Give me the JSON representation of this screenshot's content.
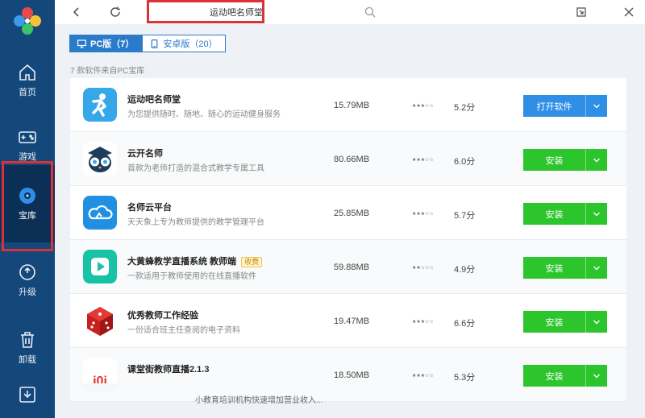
{
  "sidebar": {
    "items": [
      {
        "label": "首页",
        "icon": "home-icon"
      },
      {
        "label": "游戏",
        "icon": "gamepad-icon"
      },
      {
        "label": "宝库",
        "icon": "disc-icon",
        "active": true
      },
      {
        "label": "升级",
        "icon": "upgrade-icon"
      },
      {
        "label": "卸载",
        "icon": "trash-icon"
      },
      {
        "label": "",
        "icon": "download-icon"
      }
    ]
  },
  "search": {
    "value": "运动吧名师堂"
  },
  "tabs": [
    {
      "label": "PC版（7）",
      "active": true
    },
    {
      "label": "安卓版（20）",
      "active": false
    }
  ],
  "source_note": "7 款软件来自PC宝库",
  "apps": [
    {
      "name": "运动吧名师堂",
      "desc": "为您提供随时、随地、随心的运动健身服务",
      "size": "15.79MB",
      "score": "5.2分",
      "action": "打开软件",
      "style": "blue",
      "badge": ""
    },
    {
      "name": "云开名师",
      "desc": "首款为老师打造的混合式教学专属工具",
      "size": "80.66MB",
      "score": "6.0分",
      "action": "安装",
      "style": "green",
      "badge": ""
    },
    {
      "name": "名师云平台",
      "desc": "天天象上专为教师提供的教学管理平台",
      "size": "25.85MB",
      "score": "5.7分",
      "action": "安装",
      "style": "green",
      "badge": ""
    },
    {
      "name": "大黄蜂教学直播系统 教师端",
      "desc": "一款适用于教师使用的在线直播软件",
      "size": "59.88MB",
      "score": "4.9分",
      "action": "安装",
      "style": "green",
      "badge": "收费"
    },
    {
      "name": "优秀教师工作经验",
      "desc": "一份适合班主任查阅的电子资料",
      "size": "19.47MB",
      "score": "6.6分",
      "action": "安装",
      "style": "green",
      "badge": ""
    },
    {
      "name": "课堂街教师直播2.1.3",
      "desc": "",
      "size": "18.50MB",
      "score": "5.3分",
      "action": "安装",
      "style": "green",
      "badge": ""
    }
  ],
  "overlay_text": "小教育培训机构快速增加营业收入...",
  "colors": {
    "sidebar": "#14487a",
    "accent_blue": "#2a7bc9",
    "install_green": "#2cc52c",
    "highlight_red": "#d9323a"
  }
}
